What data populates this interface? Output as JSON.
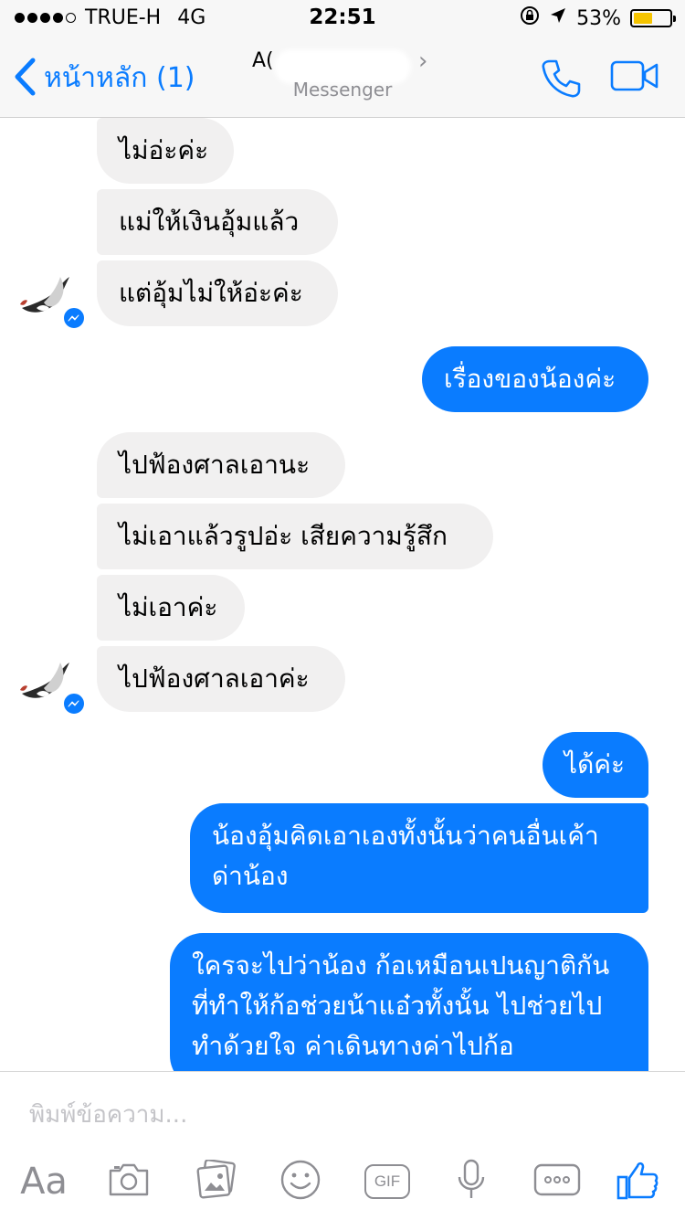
{
  "status_bar": {
    "carrier": "TRUE-H",
    "network": "4G",
    "time": "22:51",
    "battery_percent": "53%",
    "battery_level": 0.53
  },
  "header": {
    "back_label": "หน้าหลัก (1)",
    "contact_name": "A(",
    "subtitle": "Messenger"
  },
  "messages": [
    {
      "side": "in",
      "text": "ไม่อ่ะค่ะ"
    },
    {
      "side": "in",
      "text": "แม่ให้เงินอุ้มแล้ว"
    },
    {
      "side": "in",
      "text": "แต่อุ้มไม่ให้อ่ะค่ะ"
    },
    {
      "side": "out",
      "text": "เรื่องของน้องค่ะ"
    },
    {
      "side": "in",
      "text": "ไปฟ้องศาลเอานะ"
    },
    {
      "side": "in",
      "text": "ไม่เอาแล้วรูปอ่ะ เสียความรู้สึก"
    },
    {
      "side": "in",
      "text": "ไม่เอาค่ะ"
    },
    {
      "side": "in",
      "text": "ไปฟ้องศาลเอาค่ะ"
    },
    {
      "side": "out",
      "text": "ได้ค่ะ"
    },
    {
      "side": "out",
      "text": "น้องอุ้มคิดเอาเองทั้งนั้นว่าคนอื่นเค้าด่าน้อง"
    },
    {
      "side": "out",
      "text": "ใครจะไปว่าน้อง ก้อเหมือนเปนญาติกัน ที่ทำให้ก้อช่วยน้าแอ๋วทั้งนั้น ไปช่วยไปทำด้วยใจ ค่าเดินทางค่าไปก้อ"
    }
  ],
  "composer": {
    "placeholder": "พิมพ์ข้อความ...",
    "aa_label": "Aa",
    "gif_label": "GIF"
  },
  "colors": {
    "accent": "#0a7cff",
    "incoming_bubble": "#f1f0f0",
    "battery": "#f5c400"
  },
  "icons": [
    "back-chevron-icon",
    "phone-icon",
    "video-camera-icon",
    "camera-icon",
    "photo-icon",
    "emoji-icon",
    "gif-icon",
    "microphone-icon",
    "more-icon",
    "thumbs-up-icon",
    "messenger-badge-icon",
    "location-arrow-icon",
    "rotation-lock-icon"
  ]
}
